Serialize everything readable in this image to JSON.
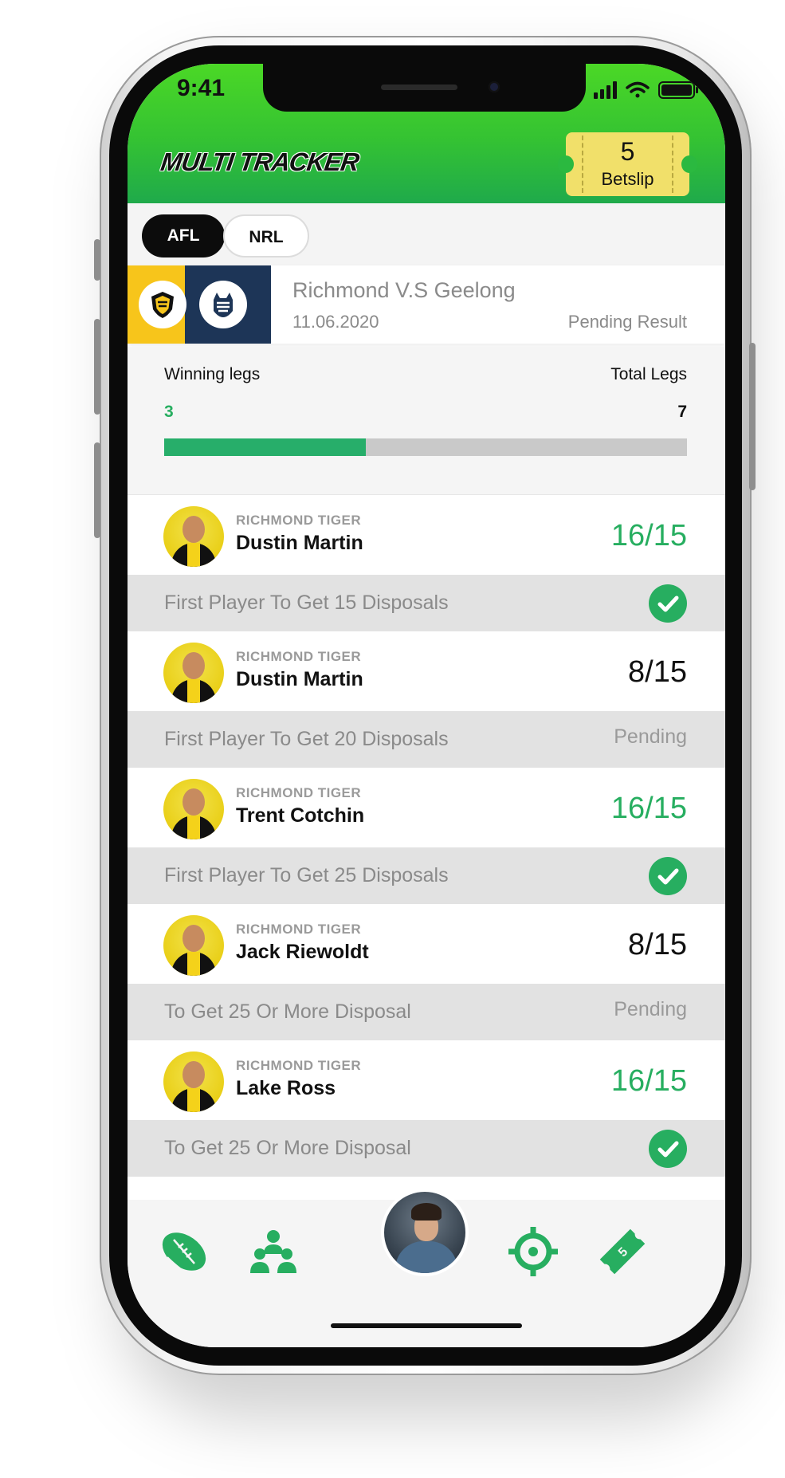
{
  "status_bar": {
    "time": "9:41"
  },
  "header": {
    "logo_text": "MULTI TRACKER",
    "betslip_count": "5",
    "betslip_label": "Betslip"
  },
  "tabs": [
    {
      "label": "AFL",
      "active": true
    },
    {
      "label": "NRL",
      "active": false
    }
  ],
  "match": {
    "title": "Richmond V.S Geelong",
    "date": "11.06.2020",
    "status": "Pending Result"
  },
  "progress": {
    "winning_label": "Winning legs",
    "total_label": "Total Legs",
    "winning_value": "3",
    "total_value": "7",
    "fraction": 0.3857
  },
  "legs": [
    {
      "team": "RICHMOND TIGER",
      "player": "Dustin Martin",
      "score": "16/15",
      "score_state": "win",
      "market": "First Player To Get 15 Disposals",
      "result": "won",
      "result_text": ""
    },
    {
      "team": "RICHMOND TIGER",
      "player": "Dustin Martin",
      "score": "8/15",
      "score_state": "pending",
      "market": "First Player To Get 20 Disposals",
      "result": "pending",
      "result_text": "Pending"
    },
    {
      "team": "RICHMOND TIGER",
      "player": "Trent Cotchin",
      "score": "16/15",
      "score_state": "win",
      "market": "First Player To Get 25 Disposals",
      "result": "won",
      "result_text": ""
    },
    {
      "team": "RICHMOND TIGER",
      "player": "Jack Riewoldt",
      "score": "8/15",
      "score_state": "pending",
      "market": "To Get 25 Or More Disposal",
      "result": "pending",
      "result_text": "Pending"
    },
    {
      "team": "RICHMOND TIGER",
      "player": "Lake Ross",
      "score": "16/15",
      "score_state": "win",
      "market": "To Get 25 Or More Disposal",
      "result": "won",
      "result_text": ""
    }
  ],
  "bottom_nav": {
    "betslip_badge": "5",
    "items": [
      "football-icon",
      "group-icon",
      "profile-avatar",
      "target-icon",
      "ticket-icon"
    ]
  },
  "colors": {
    "header_green": "#34c233",
    "accent_green": "#27ae60",
    "betslip_yellow": "#f1e06a",
    "richmond_yellow": "#f7c51b",
    "geelong_navy": "#1d3557"
  }
}
